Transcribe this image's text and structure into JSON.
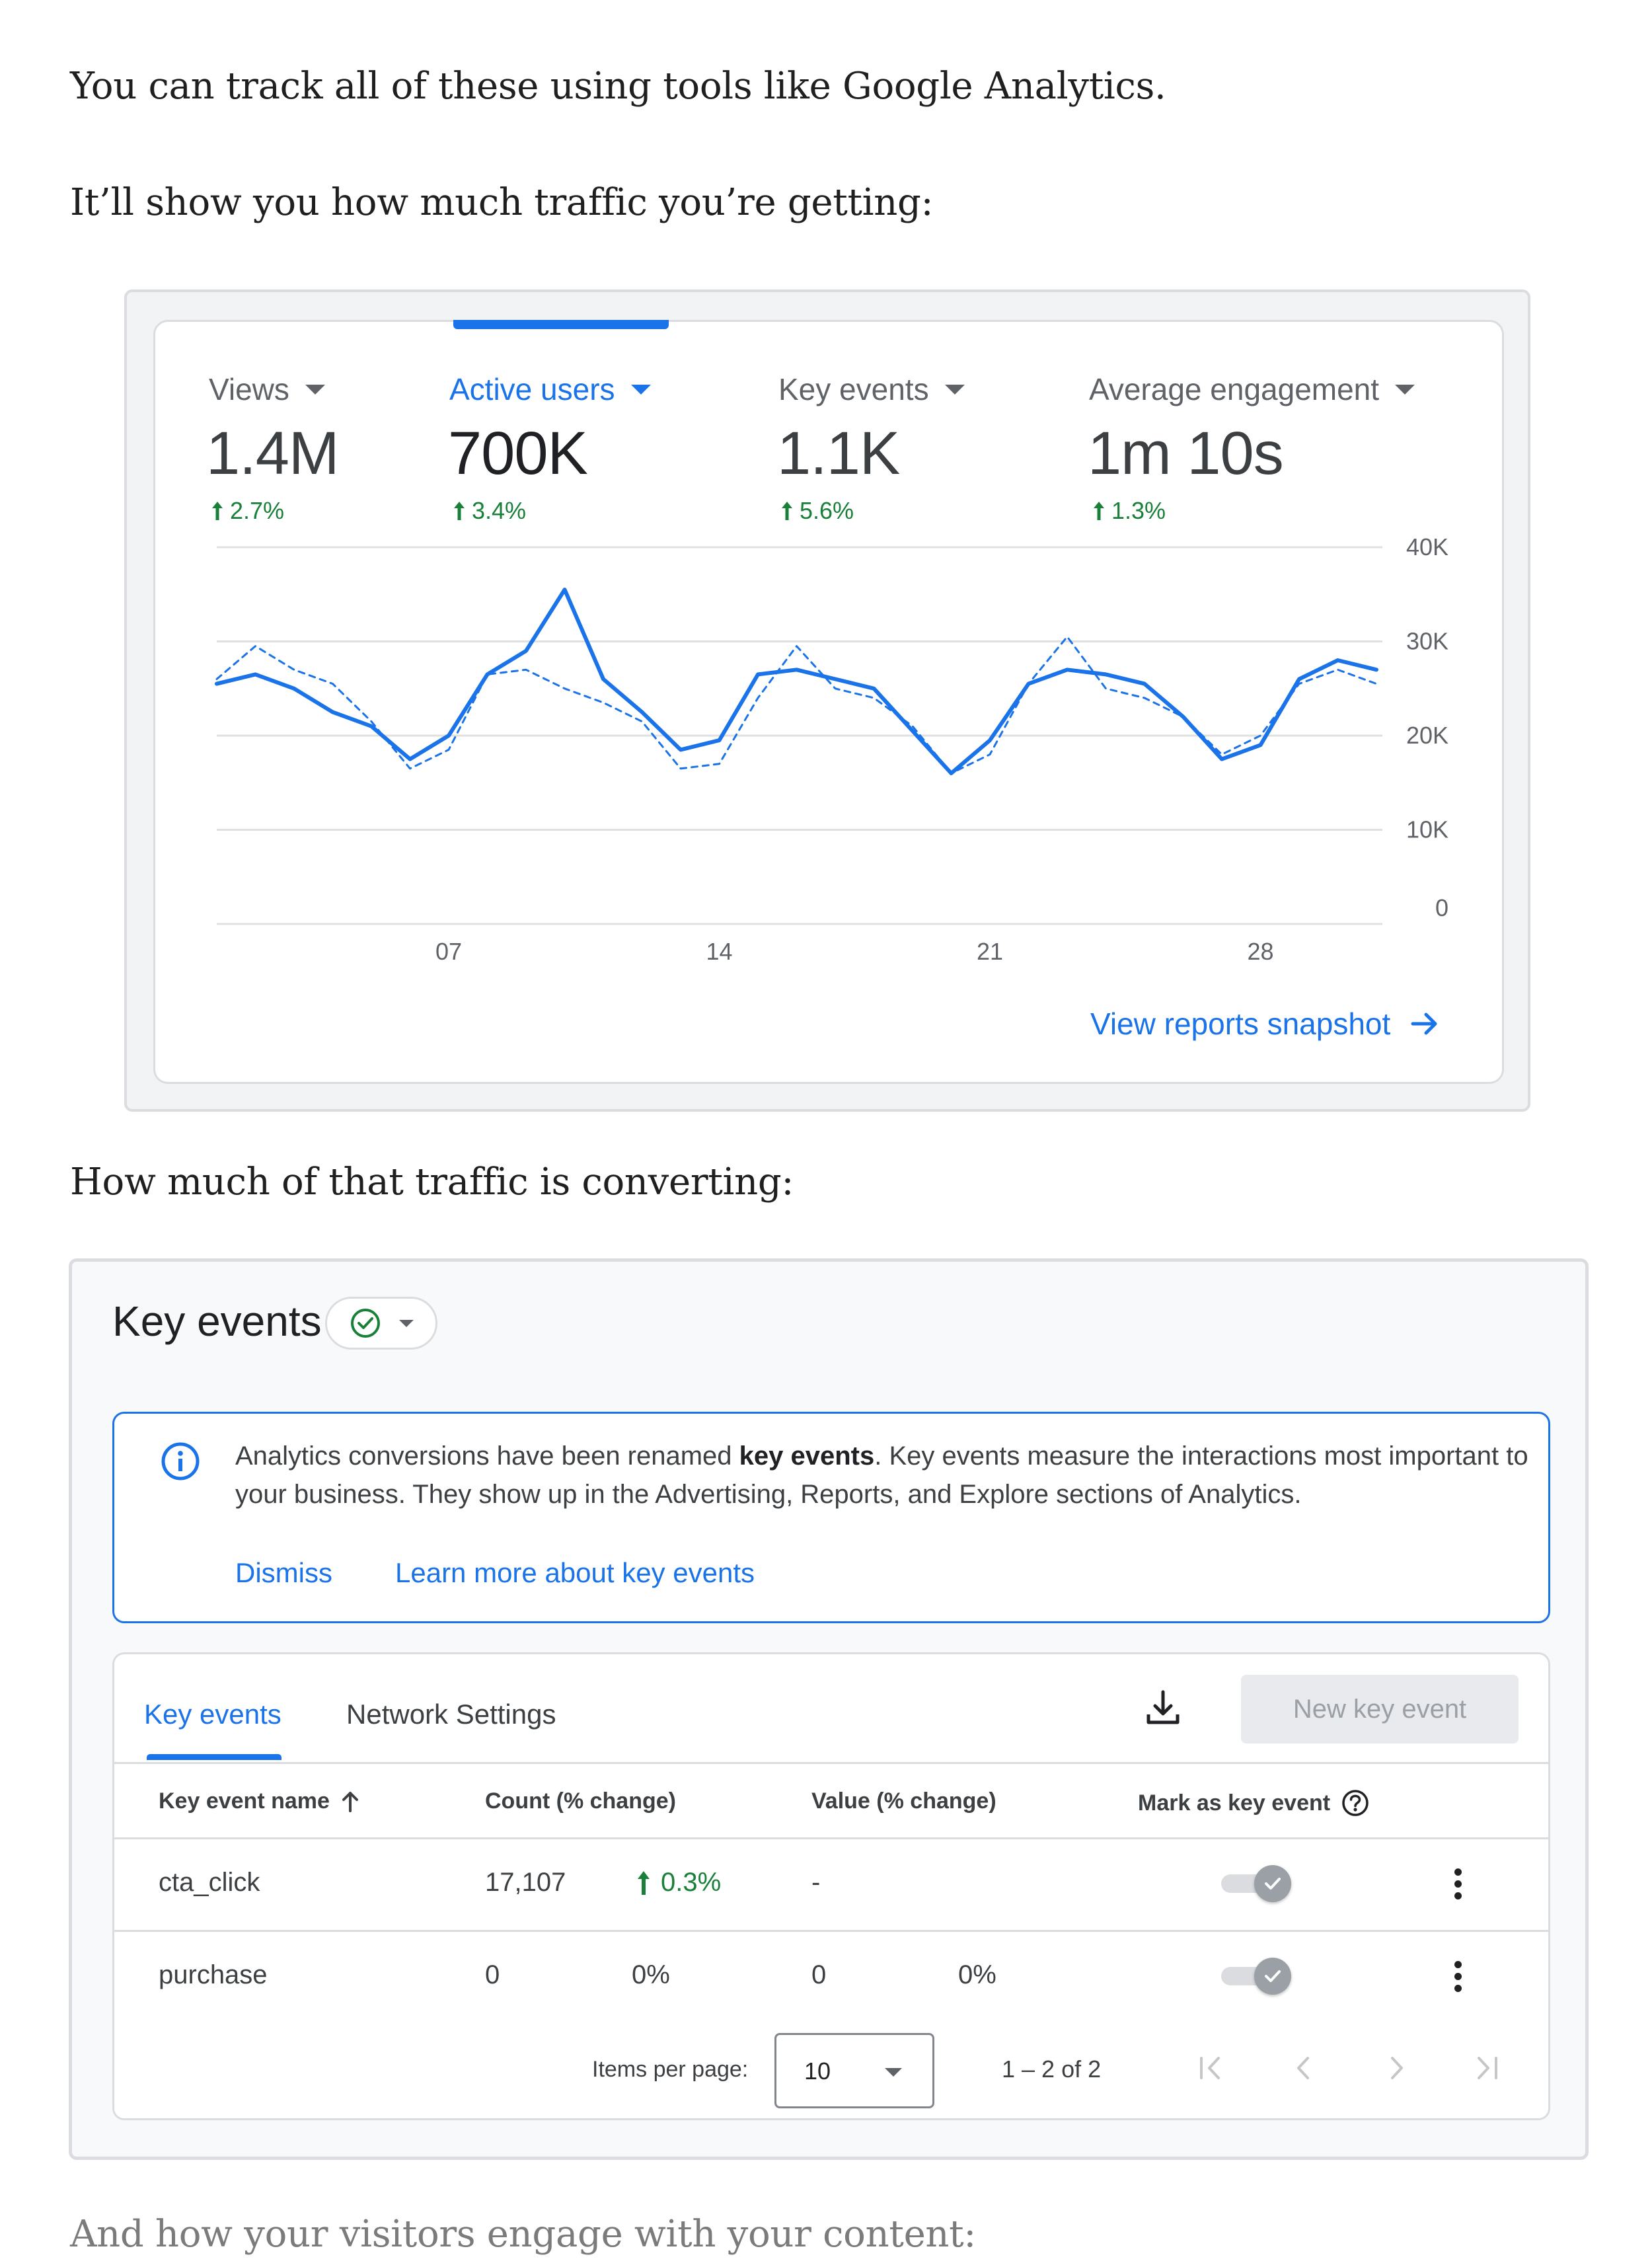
{
  "article": {
    "para1": "You can track all of these using tools like Google Analytics.",
    "para2": "It’ll show you how much traffic you’re getting:",
    "para3": "How much of that traffic is converting:",
    "para4": "And how your visitors engage with your content:"
  },
  "overview": {
    "metrics": [
      {
        "label": "Views",
        "value": "1.4M",
        "change": "2.7%",
        "active": false
      },
      {
        "label": "Active users",
        "value": "700K",
        "change": "3.4%",
        "active": true
      },
      {
        "label": "Key events",
        "value": "1.1K",
        "change": "5.6%",
        "active": false
      },
      {
        "label": "Average engagement",
        "value": "1m 10s",
        "change": "1.3%",
        "active": false
      }
    ],
    "view_link": "View reports snapshot",
    "icons": {
      "metric_dropdown": "caret-down-icon",
      "change": "arrow-up-icon",
      "link": "arrow-right-icon"
    },
    "colors": {
      "accent": "#1a73e8",
      "positive": "#188038",
      "grid": "#e0e0e0"
    }
  },
  "chart_data": {
    "type": "line",
    "x": [
      1,
      2,
      3,
      4,
      5,
      6,
      7,
      8,
      9,
      10,
      11,
      12,
      13,
      14,
      15,
      16,
      17,
      18,
      19,
      20,
      21,
      22,
      23,
      24,
      25,
      26,
      27,
      28,
      29,
      30,
      31
    ],
    "xticks": [
      "07",
      "14",
      "21",
      "28"
    ],
    "xtick_positions": [
      7,
      14,
      21,
      28
    ],
    "yticks": [
      "0",
      "10K",
      "20K",
      "30K",
      "40K"
    ],
    "ylim": [
      0,
      40000
    ],
    "grid": true,
    "series": [
      {
        "style": "solid",
        "color": "#1a73e8",
        "values": [
          25500,
          26500,
          25000,
          22500,
          21000,
          17500,
          20000,
          26500,
          29000,
          35500,
          26000,
          22500,
          18500,
          19500,
          26500,
          27000,
          26000,
          25000,
          20500,
          16000,
          19500,
          25500,
          27000,
          26500,
          25500,
          22000,
          17500,
          19000,
          26000,
          28000,
          27000
        ]
      },
      {
        "style": "dashed",
        "color": "#1a73e8",
        "values": [
          26000,
          29500,
          27000,
          25500,
          21500,
          16500,
          18500,
          26500,
          27000,
          25000,
          23500,
          21500,
          16500,
          17000,
          24000,
          29500,
          25000,
          24000,
          21000,
          16000,
          18000,
          25500,
          30500,
          25000,
          24000,
          22000,
          18000,
          20000,
          25500,
          27000,
          25500
        ]
      }
    ]
  },
  "key_events": {
    "title": "Key events",
    "status_icon": "check-circle-icon",
    "banner": {
      "text_before": "Analytics conversions have been renamed ",
      "text_bold": "key events",
      "text_after": ". Key events measure the interactions most important to your business. They show up in the Advertising, Reports, and Explore sections of Analytics.",
      "dismiss": "Dismiss",
      "learn_more": "Learn more about key events",
      "icon": "info-icon"
    },
    "tabs": [
      "Key events",
      "Network Settings"
    ],
    "new_button": "New key event",
    "columns": {
      "name": "Key event name",
      "count": "Count (% change)",
      "value": "Value (% change)",
      "mark": "Mark as key event"
    },
    "rows": [
      {
        "name": "cta_click",
        "count": "17,107",
        "count_change": "0.3%",
        "value": "-",
        "value_change": ""
      },
      {
        "name": "purchase",
        "count": "0",
        "count_change": "0%",
        "value": "0",
        "value_change": "0%"
      }
    ],
    "pagination": {
      "items_label": "Items per page:",
      "per_page": "10",
      "range": "1 – 2 of 2"
    },
    "colors": {
      "accent": "#1a73e8",
      "positive": "#188038"
    }
  }
}
